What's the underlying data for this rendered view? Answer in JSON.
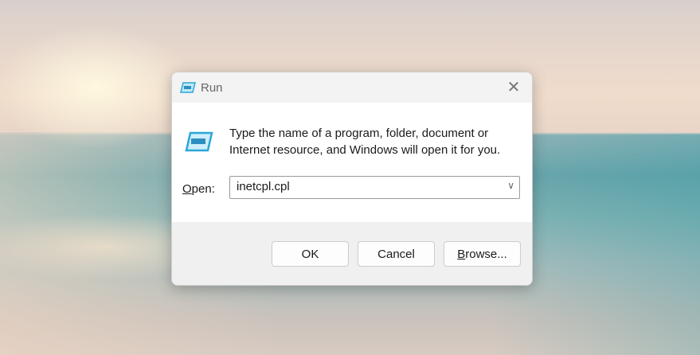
{
  "dialog": {
    "title": "Run",
    "message_line1": "Type the name of a program, folder, document or",
    "message_line2": "Internet resource, and Windows will open it for you.",
    "open_label_ul": "O",
    "open_label_rest": "pen:",
    "open_value": "inetcpl.cpl",
    "ok_label": "OK",
    "cancel_label": "Cancel",
    "browse_ul": "B",
    "browse_rest": "rowse..."
  },
  "colors": {
    "accent": "#2aa7d8"
  }
}
